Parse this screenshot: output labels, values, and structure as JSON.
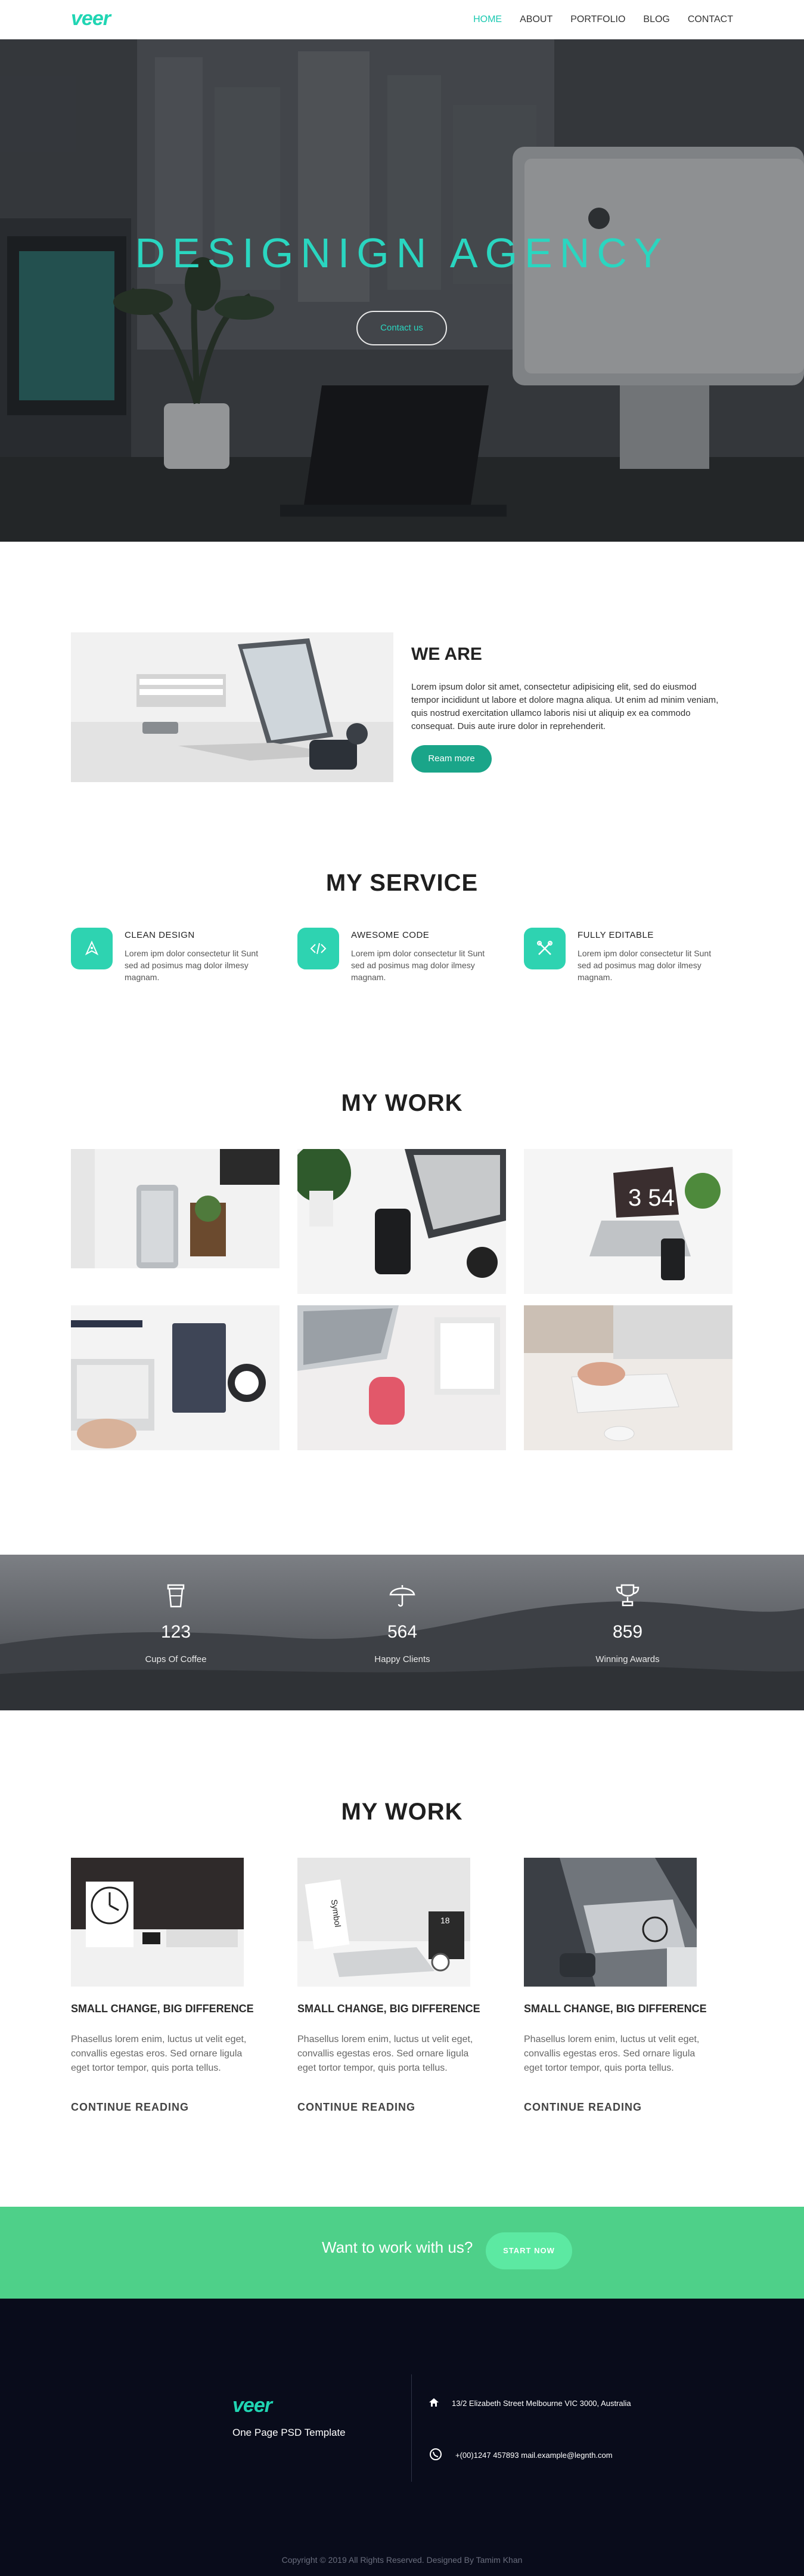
{
  "nav": {
    "logo": "veer",
    "items": [
      "HOME",
      "ABOUT",
      "PORTFOLIO",
      "BLOG",
      "CONTACT"
    ],
    "active_index": 0
  },
  "hero": {
    "title": "DESIGNIGN AGENCY",
    "button_label": "Contact us"
  },
  "about": {
    "title": "WE ARE",
    "text": "Lorem ipsum dolor sit amet, consectetur adipisicing elit, sed do eiusmod tempor incididunt ut labore et dolore magna aliqua. Ut enim ad minim veniam, quis nostrud exercitation ullamco laboris nisi ut aliquip ex ea commodo consequat. Duis aute irure dolor in reprehenderit.",
    "button_label": "Ream more"
  },
  "services": {
    "title": "MY SERVICE",
    "items": [
      {
        "title": "CLEAN DESIGN",
        "text": "Lorem ipm dolor consectetur lit Sunt sed ad posimus mag dolor ilmesy magnam.",
        "icon": "pen-nib-icon"
      },
      {
        "title": "AWESOME CODE",
        "text": "Lorem ipm dolor consectetur lit Sunt sed ad posimus mag dolor ilmesy magnam.",
        "icon": "code-icon"
      },
      {
        "title": "FULLY EDITABLE",
        "text": "Lorem ipm dolor consectetur lit Sunt sed ad posimus mag dolor ilmesy magnam.",
        "icon": "tools-icon"
      }
    ]
  },
  "portfolio": {
    "title": "MY WORK"
  },
  "counters": [
    {
      "number": "123",
      "label": "Cups Of Coffee",
      "icon": "coffee-cup-icon"
    },
    {
      "number": "564",
      "label": "Happy Clients",
      "icon": "umbrella-icon"
    },
    {
      "number": "859",
      "label": "Winning Awards",
      "icon": "trophy-icon"
    }
  ],
  "blog": {
    "title": "MY WORK",
    "posts": [
      {
        "title": "SMALL CHANGE, BIG DIFFERENCE",
        "text": "Phasellus lorem enim, luctus ut velit eget, convallis egestas eros. Sed ornare ligula eget tortor tempor, quis porta tellus.",
        "link": "CONTINUE READING"
      },
      {
        "title": "SMALL CHANGE, BIG DIFFERENCE",
        "text": "Phasellus lorem enim, luctus ut velit eget, convallis egestas eros. Sed ornare ligula eget tortor tempor, quis porta tellus.",
        "link": "CONTINUE READING"
      },
      {
        "title": "SMALL CHANGE, BIG DIFFERENCE",
        "text": "Phasellus lorem enim, luctus ut velit eget, convallis egestas eros. Sed ornare ligula eget tortor tempor, quis porta tellus.",
        "link": "CONTINUE READING"
      }
    ]
  },
  "cta": {
    "text": "Want to work with us?",
    "button_label": "START NOW"
  },
  "footer": {
    "logo": "veer",
    "tagline": "One Page PSD Template",
    "address": "13/2 Elizabeth Street Melbourne VIC 3000, Australia",
    "contact": "+(00)1247 457893 mail.example@legnth.com",
    "copyright": "Copyright © 2019 All Rights Reserved. Designed By Tamim Khan"
  },
  "colors": {
    "accent": "#20d5b3",
    "button_green": "#1aa589",
    "cta_green": "#4ed089",
    "footer_bg": "#090c1b"
  }
}
